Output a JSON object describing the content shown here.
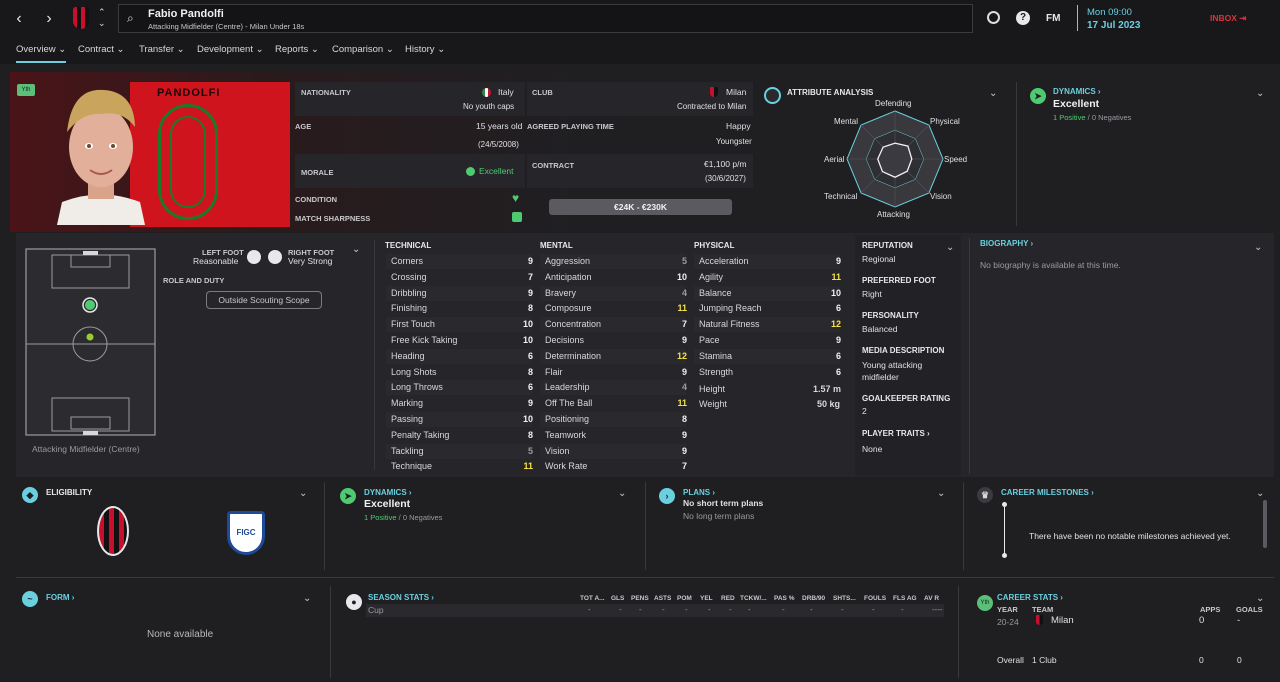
{
  "header": {
    "player_name": "Fabio Pandolfi",
    "player_subtitle": "Attacking Midfielder (Centre) - Milan Under 18s",
    "time": "Mon 09:00",
    "date": "17 Jul 2023",
    "inbox_label": "INBOX",
    "fm_label": "FM"
  },
  "tabs": [
    "Overview",
    "Contract",
    "Transfer",
    "Development",
    "Reports",
    "Comparison",
    "History"
  ],
  "profile": {
    "yth_badge": "Yth",
    "shirt_name": "PANDOLFI",
    "shirt_number": "0",
    "nationality_label": "NATIONALITY",
    "nationality_value": "Italy",
    "nationality_sub": "No youth caps",
    "club_label": "CLUB",
    "club_value": "Milan",
    "club_sub": "Contracted to Milan",
    "age_label": "AGE",
    "age_value": "15 years old",
    "age_sub": "(24/5/2008)",
    "playing_time_label": "AGREED PLAYING TIME",
    "playing_time_value": "Happy",
    "playing_time_sub": "Youngster",
    "morale_label": "MORALE",
    "morale_value": "Excellent",
    "contract_label": "CONTRACT",
    "contract_value": "€1,100 p/m",
    "contract_sub": "(30/6/2027)",
    "condition_label": "CONDITION",
    "sharpness_label": "MATCH SHARPNESS",
    "value_range": "€24K - €230K"
  },
  "attribute_analysis": {
    "title": "ATTRIBUTE ANALYSIS",
    "axes": [
      "Defending",
      "Physical",
      "Speed",
      "Vision",
      "Attacking",
      "Technical",
      "Aerial",
      "Mental"
    ]
  },
  "dynamics_top": {
    "title": "DYNAMICS",
    "value": "Excellent",
    "positives": "1 Positive",
    "sep": "/",
    "negatives": "0 Negatives"
  },
  "feet": {
    "left_label": "LEFT FOOT",
    "left_value": "Reasonable",
    "right_label": "RIGHT FOOT",
    "right_value": "Very Strong"
  },
  "role": {
    "title": "ROLE AND DUTY",
    "button": "Outside Scouting Scope",
    "position": "Attacking Midfielder (Centre)"
  },
  "technical": {
    "title": "TECHNICAL",
    "rows": [
      {
        "n": "Corners",
        "v": "9"
      },
      {
        "n": "Crossing",
        "v": "7"
      },
      {
        "n": "Dribbling",
        "v": "9"
      },
      {
        "n": "Finishing",
        "v": "8"
      },
      {
        "n": "First Touch",
        "v": "10"
      },
      {
        "n": "Free Kick Taking",
        "v": "10"
      },
      {
        "n": "Heading",
        "v": "6"
      },
      {
        "n": "Long Shots",
        "v": "8"
      },
      {
        "n": "Long Throws",
        "v": "6"
      },
      {
        "n": "Marking",
        "v": "9"
      },
      {
        "n": "Passing",
        "v": "10"
      },
      {
        "n": "Penalty Taking",
        "v": "8"
      },
      {
        "n": "Tackling",
        "v": "5"
      },
      {
        "n": "Technique",
        "v": "11"
      }
    ]
  },
  "mental": {
    "title": "MENTAL",
    "rows": [
      {
        "n": "Aggression",
        "v": "5"
      },
      {
        "n": "Anticipation",
        "v": "10"
      },
      {
        "n": "Bravery",
        "v": "4"
      },
      {
        "n": "Composure",
        "v": "11"
      },
      {
        "n": "Concentration",
        "v": "7"
      },
      {
        "n": "Decisions",
        "v": "9"
      },
      {
        "n": "Determination",
        "v": "12"
      },
      {
        "n": "Flair",
        "v": "9"
      },
      {
        "n": "Leadership",
        "v": "4"
      },
      {
        "n": "Off The Ball",
        "v": "11"
      },
      {
        "n": "Positioning",
        "v": "8"
      },
      {
        "n": "Teamwork",
        "v": "9"
      },
      {
        "n": "Vision",
        "v": "9"
      },
      {
        "n": "Work Rate",
        "v": "7"
      }
    ]
  },
  "physical": {
    "title": "PHYSICAL",
    "rows": [
      {
        "n": "Acceleration",
        "v": "9"
      },
      {
        "n": "Agility",
        "v": "11"
      },
      {
        "n": "Balance",
        "v": "10"
      },
      {
        "n": "Jumping Reach",
        "v": "6"
      },
      {
        "n": "Natural Fitness",
        "v": "12"
      },
      {
        "n": "Pace",
        "v": "9"
      },
      {
        "n": "Stamina",
        "v": "6"
      },
      {
        "n": "Strength",
        "v": "6"
      }
    ],
    "height_label": "Height",
    "height_value": "1.57 m",
    "weight_label": "Weight",
    "weight_value": "50 kg"
  },
  "info": {
    "reputation_label": "REPUTATION",
    "reputation_value": "Regional",
    "foot_label": "PREFERRED FOOT",
    "foot_value": "Right",
    "personality_label": "PERSONALITY",
    "personality_value": "Balanced",
    "media_label": "MEDIA DESCRIPTION",
    "media_value": "Young attacking midfielder",
    "gk_label": "GOALKEEPER RATING",
    "gk_value": "2",
    "traits_label": "PLAYER TRAITS",
    "traits_value": "None"
  },
  "biography": {
    "title": "BIOGRAPHY",
    "text": "No biography is available at this time."
  },
  "eligibility": {
    "title": "ELIGIBILITY"
  },
  "dynamics_mid": {
    "title": "DYNAMICS",
    "value": "Excellent",
    "positives": "1 Positive",
    "sep": "/",
    "negatives": "0 Negatives"
  },
  "plans": {
    "title": "PLANS",
    "short": "No short term plans",
    "long": "No long term plans"
  },
  "milestones": {
    "title": "CAREER MILESTONES",
    "text": "There have been no notable milestones achieved yet."
  },
  "form": {
    "title": "FORM",
    "text": "None available"
  },
  "season_stats": {
    "title": "SEASON STATS",
    "headers": [
      "TOT A...",
      "GLS",
      "PENS",
      "ASTS",
      "POM",
      "YEL",
      "RED",
      "TCKW/...",
      "PAS %",
      "DRB/90",
      "SHTS...",
      "FOULS",
      "FLS AG",
      "AV R"
    ],
    "row_label": "Cup",
    "row_values": [
      "-",
      "-",
      "-",
      "-",
      "-",
      "-",
      "-",
      "-",
      "-",
      "-",
      "-",
      "-",
      "-",
      "----"
    ]
  },
  "career_stats": {
    "title": "CAREER STATS",
    "badge": "Yth",
    "year_h": "YEAR",
    "team_h": "TEAM",
    "apps_h": "APPS",
    "goals_h": "GOALS",
    "row_year": "20-24",
    "row_team": "Milan",
    "row_apps": "0",
    "row_goals": "-",
    "overall_label": "Overall",
    "overall_clubs": "1 Club",
    "overall_apps": "0",
    "overall_goals": "0"
  },
  "colors": {
    "accent": "#6ad0e0",
    "red": "#d0141e",
    "green": "#4ecb71",
    "yellow": "#f5e04a",
    "inbox": "#e0303a"
  }
}
